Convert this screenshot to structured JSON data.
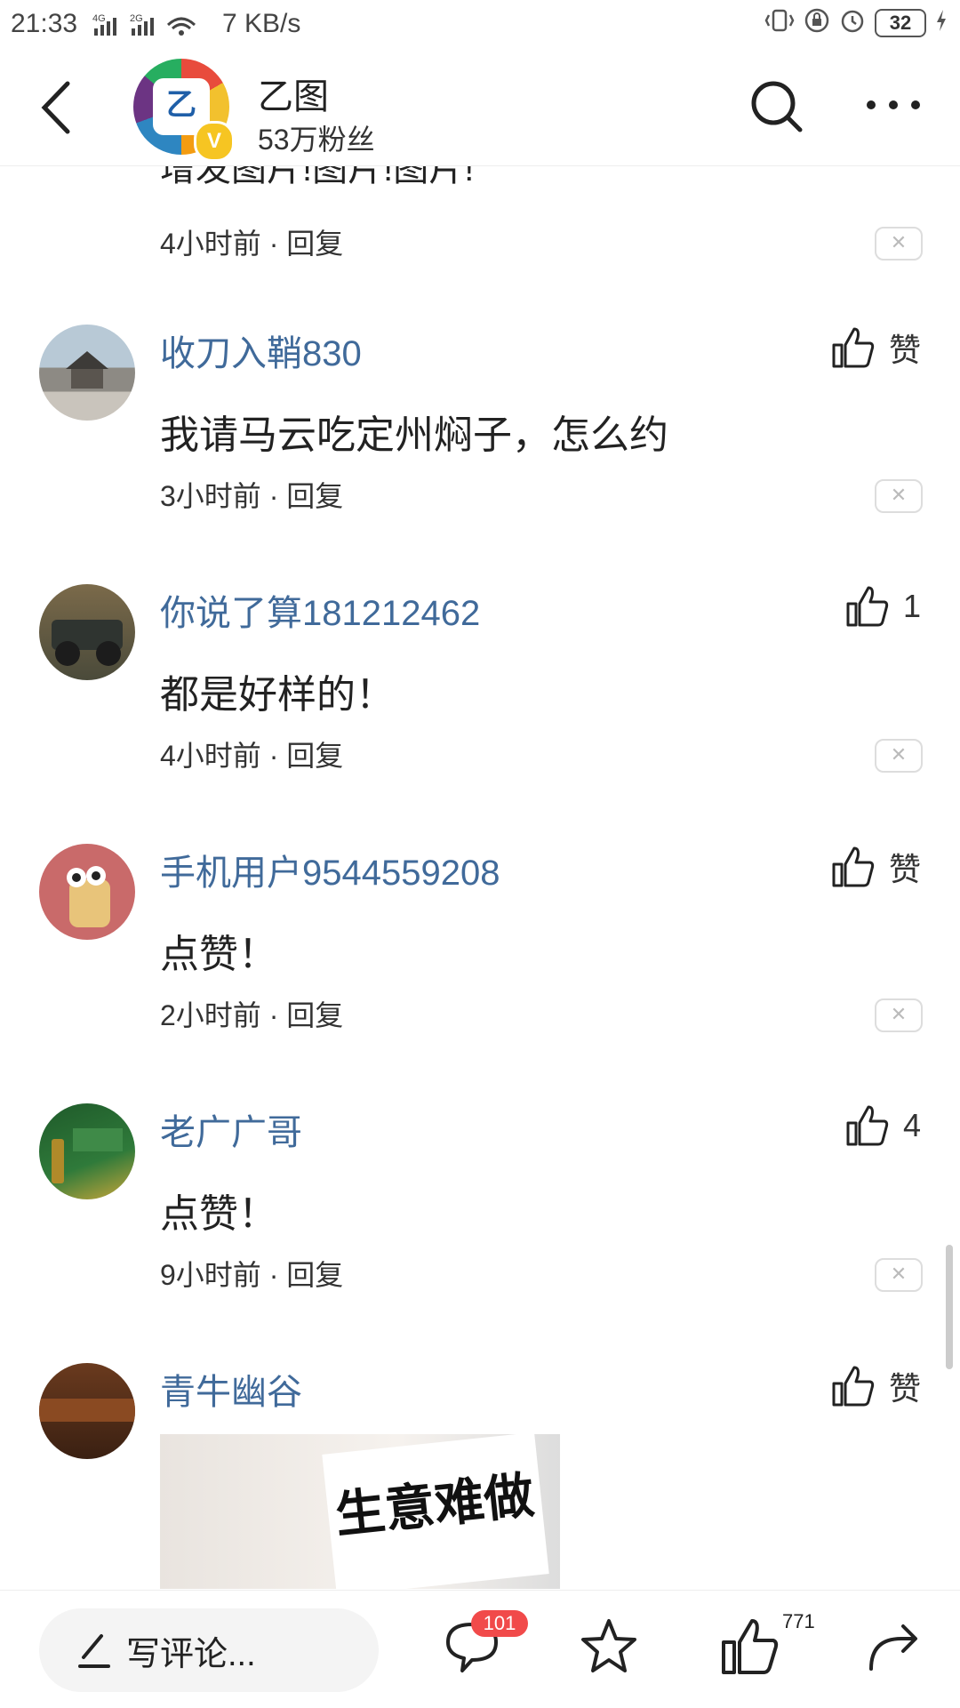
{
  "status_bar": {
    "time": "21:33",
    "network_speed": "7 KB/s",
    "battery": "32"
  },
  "header": {
    "account_name": "乙图",
    "followers": "53万粉丝",
    "logo_text": "乙",
    "verified_mark": "V"
  },
  "comments": {
    "truncated_text": "增发图片!图片!图片!",
    "truncated_meta": "4小时前 · 回复",
    "items": [
      {
        "user": "收刀入鞘830",
        "like": "赞",
        "text": "我请马云吃定州焖子，怎么约",
        "meta": "3小时前 · 回复"
      },
      {
        "user": "你说了算181212462",
        "like": "1",
        "text": "都是好样的！",
        "meta": "4小时前 · 回复"
      },
      {
        "user": "手机用户9544559208",
        "like": "赞",
        "text": "点赞！",
        "meta": "2小时前 · 回复"
      },
      {
        "user": "老广广哥",
        "like": "4",
        "text": "点赞！",
        "meta": "9小时前 · 回复"
      },
      {
        "user": "青牛幽谷",
        "like": "赞",
        "photo_text": "生意难做"
      }
    ],
    "close_glyph": "✕"
  },
  "bottom_bar": {
    "write_placeholder": "写评论...",
    "comment_count": "101",
    "like_count": "771"
  },
  "colors": {
    "username": "#406a9a",
    "badge": "#f14a4a"
  }
}
